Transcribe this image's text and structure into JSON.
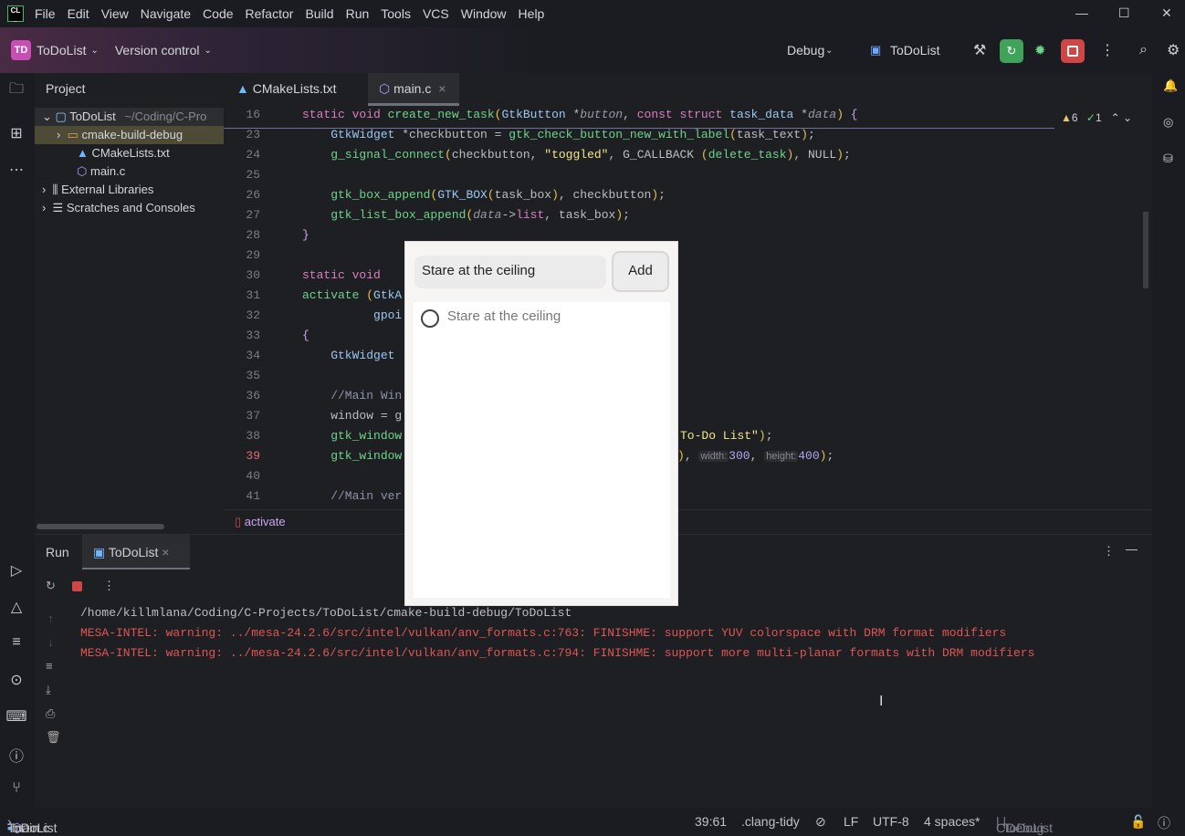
{
  "menu": [
    "File",
    "Edit",
    "View",
    "Navigate",
    "Code",
    "Refactor",
    "Build",
    "Run",
    "Tools",
    "VCS",
    "Window",
    "Help"
  ],
  "toolbar": {
    "project_initials": "TD",
    "project": "ToDoList",
    "vcs": "Version control",
    "config": "Debug",
    "run_target": "ToDoList"
  },
  "project_panel": {
    "title": "Project",
    "root": "ToDoList",
    "root_path": "~/Coding/C-Pro",
    "items": [
      "cmake-build-debug",
      "CMakeLists.txt",
      "main.c",
      "External Libraries",
      "Scratches and Consoles"
    ]
  },
  "tabs": [
    {
      "label": "CMakeLists.txt"
    },
    {
      "label": "main.c"
    }
  ],
  "inspections": {
    "warnings": "6",
    "ok": "1"
  },
  "code": [
    {
      "n": "16",
      "t": [
        [
          "kw",
          "static void "
        ],
        [
          "fn",
          "create_new_task"
        ],
        [
          "pn",
          "("
        ],
        [
          "ty",
          "GtkButton "
        ],
        [
          "",
          "*"
        ],
        [
          "pm",
          "button"
        ],
        [
          "",
          ", "
        ],
        [
          "kw",
          "const struct "
        ],
        [
          "ty",
          "task_data "
        ],
        [
          "",
          "*"
        ],
        [
          "pm",
          "data"
        ],
        [
          "pn",
          ")"
        ],
        [
          "mc",
          " {"
        ]
      ]
    },
    {
      "n": "23",
      "t": [
        [
          "ty",
          "    GtkWidget "
        ],
        [
          "",
          "*checkbutton = "
        ],
        [
          "fn",
          "gtk_check_button_new_with_label"
        ],
        [
          "pn",
          "("
        ],
        [
          "",
          "task_text"
        ],
        [
          "pn",
          ")"
        ],
        [
          "",
          ";"
        ]
      ]
    },
    {
      "n": "24",
      "t": [
        [
          "fn",
          "    g_signal_connect"
        ],
        [
          "pn",
          "("
        ],
        [
          "",
          "checkbutton, "
        ],
        [
          "st",
          "\"toggled\""
        ],
        [
          "",
          ", G_CALLBACK "
        ],
        [
          "pn",
          "("
        ],
        [
          "fn",
          "delete_task"
        ],
        [
          "pn",
          ")"
        ],
        [
          "",
          ", NULL"
        ],
        [
          "pn",
          ")"
        ],
        [
          "",
          ";"
        ]
      ]
    },
    {
      "n": "25",
      "t": []
    },
    {
      "n": "26",
      "t": [
        [
          "fn",
          "    gtk_box_append"
        ],
        [
          "pn",
          "("
        ],
        [
          "ty",
          "GTK_BOX"
        ],
        [
          "pn",
          "("
        ],
        [
          "",
          "task_box"
        ],
        [
          "pn",
          ")"
        ],
        [
          "",
          ", checkbutton"
        ],
        [
          "pn",
          ")"
        ],
        [
          "",
          ";"
        ]
      ]
    },
    {
      "n": "27",
      "t": [
        [
          "fn",
          "    gtk_list_box_append"
        ],
        [
          "pn",
          "("
        ],
        [
          "pm",
          "data"
        ],
        [
          "",
          "->"
        ],
        [
          "kw",
          "list"
        ],
        [
          "",
          ", task_box"
        ],
        [
          "pn",
          ")"
        ],
        [
          "",
          ";"
        ]
      ]
    },
    {
      "n": "28",
      "t": [
        [
          "mc",
          "}"
        ]
      ]
    },
    {
      "n": "29",
      "t": []
    },
    {
      "n": "30",
      "t": [
        [
          "kw",
          "static void"
        ]
      ]
    },
    {
      "n": "31",
      "t": [
        [
          "fn",
          "activate "
        ],
        [
          "pn",
          "("
        ],
        [
          "ty",
          "GtkA"
        ]
      ]
    },
    {
      "n": "32",
      "t": [
        [
          "ty",
          "          gpoi"
        ]
      ]
    },
    {
      "n": "33",
      "t": [
        [
          "mc",
          "{"
        ]
      ]
    },
    {
      "n": "34",
      "t": [
        [
          "ty",
          "    GtkWidget"
        ]
      ]
    },
    {
      "n": "35",
      "t": []
    },
    {
      "n": "36",
      "t": [
        [
          "cm",
          "    //Main Win"
        ]
      ]
    },
    {
      "n": "37",
      "t": [
        [
          "",
          "    window = g"
        ]
      ]
    },
    {
      "n": "38",
      "t": [
        [
          "fn",
          "    gtk_window"
        ]
      ],
      "r": [
        [
          "st",
          "To-Do List\""
        ],
        [
          "pn",
          ")"
        ],
        [
          "",
          ";"
        ]
      ]
    },
    {
      "n": "39",
      "t": [
        [
          "fn",
          "    gtk_window"
        ]
      ],
      "r": [
        [
          "pn",
          ")"
        ],
        [
          "",
          ", "
        ],
        [
          "hint",
          "width:"
        ],
        [
          "nu",
          "300"
        ],
        [
          "",
          ", "
        ],
        [
          "hint",
          "height:"
        ],
        [
          "nu",
          "400"
        ],
        [
          "pn",
          ")"
        ],
        [
          "",
          ";"
        ]
      ]
    },
    {
      "n": "40",
      "t": []
    },
    {
      "n": "41",
      "t": [
        [
          "cm",
          "    //Main ver"
        ]
      ]
    }
  ],
  "breadcrumb_fn": "activate",
  "run": {
    "tab_run": "Run",
    "tab_target": "ToDoList",
    "lines": [
      "/home/killmlana/Coding/C-Projects/ToDoList/cmake-build-debug/ToDoList",
      "MESA-INTEL: warning: ../mesa-24.2.6/src/intel/vulkan/anv_formats.c:763: FINISHME: support YUV colorspace with DRM format modifiers",
      "MESA-INTEL: warning: ../mesa-24.2.6/src/intel/vulkan/anv_formats.c:794: FINISHME: support more multi-planar formats with DRM modifiers"
    ]
  },
  "gtk_app": {
    "entry_value": "Stare at the ceiling",
    "add_label": "Add",
    "tasks": [
      "Stare at the ceiling"
    ]
  },
  "status": {
    "project": "ToDoList",
    "file": "main.c",
    "position": "39:61",
    "linter": ".clang-tidy",
    "line_ending": "LF",
    "encoding": "UTF-8",
    "indent": "4 spaces*",
    "lang": "C",
    "context": "ToDoList",
    "config": "Debug"
  }
}
